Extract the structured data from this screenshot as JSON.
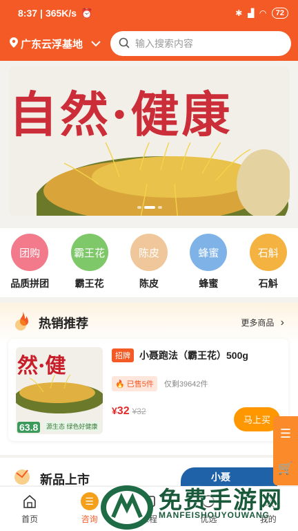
{
  "status": {
    "time": "8:37",
    "speed": "365K/s",
    "battery": "72"
  },
  "header": {
    "location": "广东云浮基地",
    "search_placeholder": "输入搜索内容"
  },
  "categories": [
    {
      "circle_text": "团购",
      "label": "品质拼团",
      "color": "#f27a8a"
    },
    {
      "circle_text": "霸王花",
      "label": "霸王花",
      "color": "#7ec86a"
    },
    {
      "circle_text": "陈皮",
      "label": "陈皮",
      "color": "#f0c79a"
    },
    {
      "circle_text": "蜂蜜",
      "label": "蜂蜜",
      "color": "#7fb3e8"
    },
    {
      "circle_text": "石斛",
      "label": "石斛",
      "color": "#f4b240"
    }
  ],
  "hot": {
    "title": "热销推荐",
    "more": "更多商品",
    "product": {
      "tag": "招牌",
      "name": "小聂跑法（霸王花）500g",
      "sold": "已售5件",
      "stock": "仅剩39642件",
      "price": "32",
      "currency": "¥",
      "original_price": "¥32",
      "buy_label": "马上买",
      "thumb_text": "然·健",
      "thumb_price": "63.8",
      "thumb_eco": "源生态 绿色好健康"
    }
  },
  "new_section": {
    "title": "新品上市",
    "promo": "小聂"
  },
  "banner": {
    "text": "自然·健康"
  },
  "tabs": [
    {
      "label": "首页",
      "icon": "home-icon"
    },
    {
      "label": "咨询",
      "icon": "chat-icon",
      "active": true
    },
    {
      "label": "课程",
      "icon": "course-icon"
    },
    {
      "label": "优选",
      "icon": "select-icon"
    },
    {
      "label": "我的",
      "icon": "user-icon"
    }
  ],
  "watermark": {
    "title": "免费手游网",
    "sub": "MANFEISHOUYOUWANG"
  },
  "colors": {
    "brand": "#f45a25",
    "buy": "#ff9800",
    "price": "#e02a2a"
  }
}
